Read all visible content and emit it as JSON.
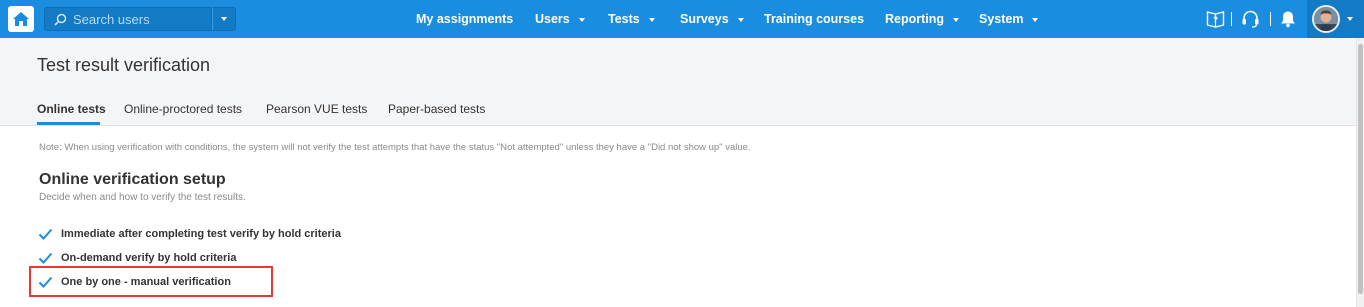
{
  "search": {
    "placeholder": "Search users"
  },
  "nav": {
    "my_assignments": "My assignments",
    "users": "Users",
    "tests": "Tests",
    "surveys": "Surveys",
    "training_courses": "Training courses",
    "reporting": "Reporting",
    "system": "System"
  },
  "page": {
    "title": "Test result verification",
    "tabs": [
      "Online tests",
      "Online-proctored tests",
      "Pearson VUE tests",
      "Paper-based tests"
    ],
    "active_tab": "Online tests"
  },
  "content": {
    "note": "Note: When using verification with conditions, the system will not verify the test attempts that have the status \"Not attempted\" unless they have a \"Did not show up\" value.",
    "section_title": "Online verification setup",
    "section_desc": "Decide when and how to verify the test results.",
    "options": [
      {
        "label": "Immediate after completing test verify by hold criteria",
        "checked": true
      },
      {
        "label": "On-demand verify by hold criteria",
        "checked": true
      },
      {
        "label": "One by one - manual verification",
        "checked": true
      }
    ]
  },
  "colors": {
    "topbar": "#1a8de0",
    "accent": "#1a8de0",
    "highlight": "#e53935"
  },
  "icons": [
    "home-icon",
    "search-icon",
    "chevron-down-icon",
    "help-book-icon",
    "headset-icon",
    "bell-icon",
    "avatar",
    "checkmark-icon"
  ]
}
